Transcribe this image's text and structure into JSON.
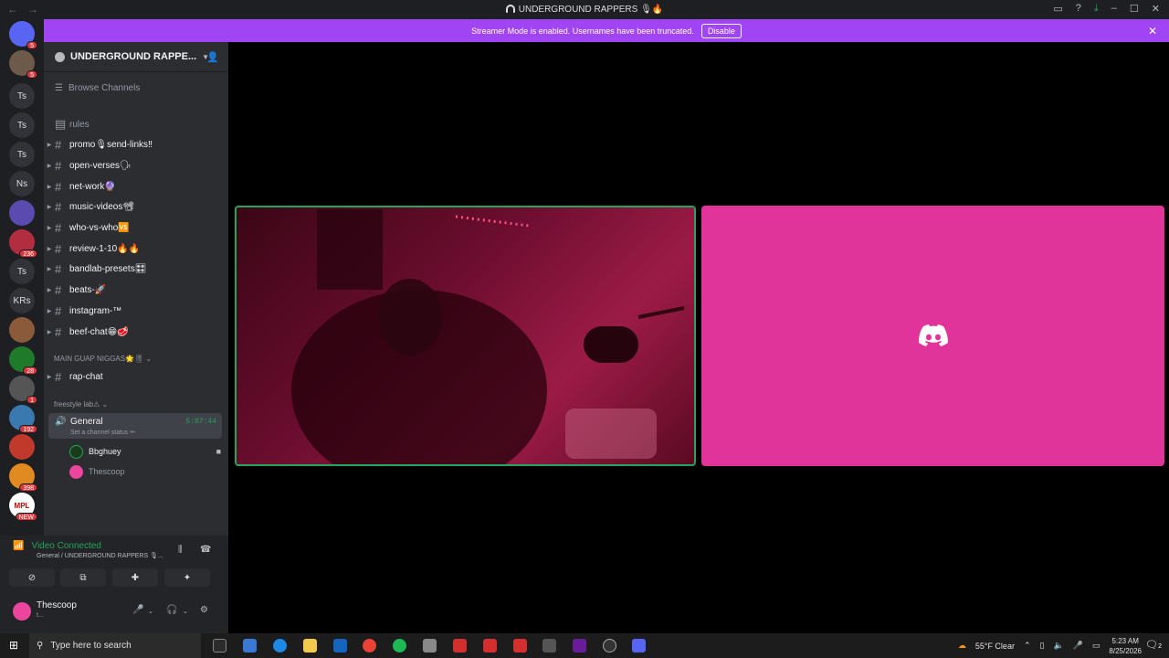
{
  "window": {
    "title": "UNDERGROUND RAPPERS 🎙🔥"
  },
  "banner": {
    "text": "Streamer Mode is enabled. Usernames have been truncated.",
    "button": "Disable"
  },
  "guilds": [
    {
      "label": "",
      "badge": "5",
      "color": "#5865f2"
    },
    {
      "label": "",
      "badge": "5",
      "color": "#6d5a4a"
    },
    {
      "label": "Ts",
      "badge": ""
    },
    {
      "label": "Ts",
      "badge": ""
    },
    {
      "label": "Ts",
      "badge": ""
    },
    {
      "label": "Ns",
      "badge": ""
    },
    {
      "label": "",
      "badge": "",
      "color": "#5b4bb0"
    },
    {
      "label": "",
      "badge": "236",
      "color": "#b32d40"
    },
    {
      "label": "Ts",
      "badge": ""
    },
    {
      "label": "KRs",
      "badge": ""
    },
    {
      "label": "",
      "badge": "",
      "color": "#8a5a3a"
    },
    {
      "label": "",
      "badge": "28",
      "color": "#1f7a2a"
    },
    {
      "label": "",
      "badge": "1",
      "color": "#555"
    },
    {
      "label": "",
      "badge": "192",
      "color": "#3a78b0"
    },
    {
      "label": "",
      "badge": "",
      "color": "#c0392b"
    },
    {
      "label": "",
      "badge": "398",
      "color": "#e08a20"
    },
    {
      "label": "MPL",
      "badge": "NEW",
      "color": "#ffffff"
    }
  ],
  "server": {
    "name": "UNDERGROUND RAPPE...",
    "browse": "Browse Channels"
  },
  "channels": [
    {
      "name": "rules",
      "muted": true
    },
    {
      "name": "promo🎙send-links‼"
    },
    {
      "name": "open-verses🗣"
    },
    {
      "name": "net-work🔮"
    },
    {
      "name": "music-videos📽"
    },
    {
      "name": "who-vs-who🆚"
    },
    {
      "name": "review-1-10🔥🔥"
    },
    {
      "name": "bandlab-presets🎛"
    },
    {
      "name": "beats-🚀"
    },
    {
      "name": "instagram-™"
    },
    {
      "name": "beef-chat😁🥩"
    }
  ],
  "categories": {
    "main": "MAIN GUAP NIGGAS🌟🎚",
    "freestyle": "freestyle lab⚠"
  },
  "rap_chat": "rap-chat",
  "voice": {
    "name": "General",
    "time": "5:07:44",
    "status": "Set a channel status ✏"
  },
  "voice_users": [
    "Bbghuey",
    "Thescoop"
  ],
  "connection": {
    "status": "Video Connected",
    "detail": "General / UNDERGROUND RAPPERS 🎙..."
  },
  "user": {
    "name": "Thescoop",
    "status": "t..."
  },
  "taskbar": {
    "search": "Type here to search",
    "weather": "55°F  Clear",
    "time": "5:23 AM",
    "date": "8/25/2026",
    "notif": "2"
  }
}
